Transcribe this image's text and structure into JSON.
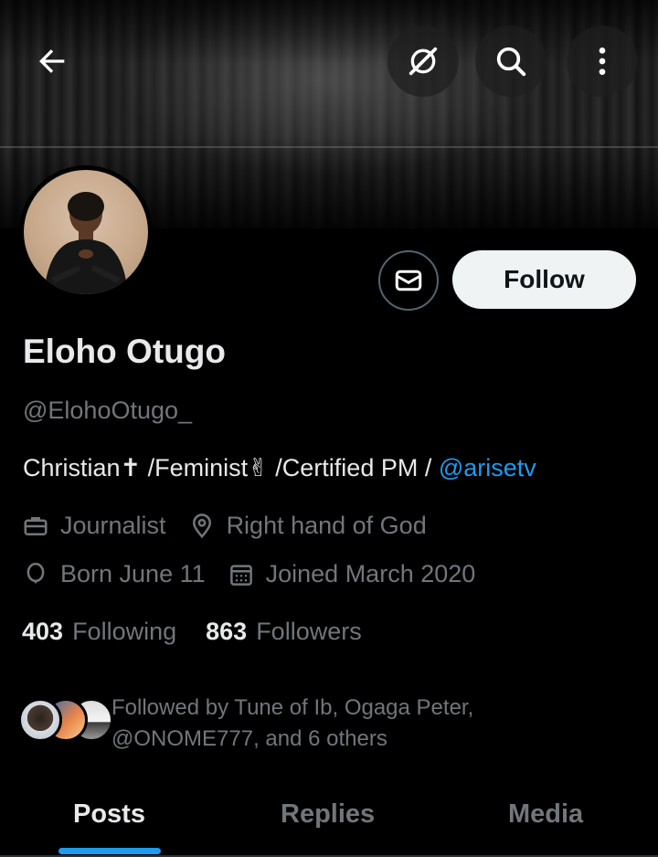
{
  "header": {
    "back_icon": "arrow-left-icon",
    "grok_icon": "grok-icon",
    "search_icon": "search-icon",
    "more_icon": "more-vertical-icon"
  },
  "profile": {
    "name": "Eloho Otugo",
    "handle": "@ElohoOtugo_",
    "bio_text": "Christian✝ /Feminist✌ /Certified PM / ",
    "bio_mention": "@arisetv",
    "occupation": "Journalist",
    "location": "Right hand of God",
    "birthday": "Born June 11",
    "joined": "Joined March 2020"
  },
  "actions": {
    "message_icon": "envelope-icon",
    "follow_label": "Follow"
  },
  "stats": {
    "following_count": "403",
    "following_label": "Following",
    "followers_count": "863",
    "followers_label": "Followers"
  },
  "followed_by": {
    "text": "Followed by Tune of Ib, Ogaga Peter, @ONOME777, and 6 others"
  },
  "tabs": [
    {
      "label": "Posts",
      "active": true
    },
    {
      "label": "Replies",
      "active": false
    },
    {
      "label": "Media",
      "active": false
    }
  ],
  "colors": {
    "background": "#000000",
    "primary_text": "#e7e9ea",
    "secondary_text": "#71767b",
    "accent": "#1d9bf0",
    "follow_button_bg": "#eff3f4"
  }
}
